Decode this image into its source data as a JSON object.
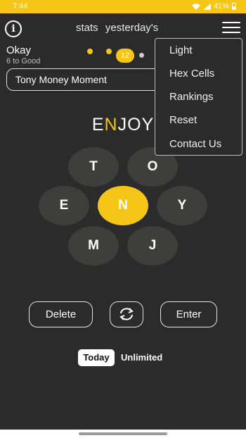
{
  "status": {
    "time": "7:44",
    "battery": "41%"
  },
  "header": {
    "info_icon": "info-icon",
    "nav": [
      "stats",
      "yesterday's"
    ],
    "menu_icon": "hamburger-menu-icon"
  },
  "progress": {
    "rank": "Okay",
    "to_next": "6 to Good",
    "score": "12"
  },
  "found_words": "Tony Money Moment",
  "current_word": {
    "before": "E",
    "center": "N",
    "after": "JOY"
  },
  "letters": {
    "top_left": "T",
    "top_right": "O",
    "left": "E",
    "center": "N",
    "right": "Y",
    "bottom_left": "M",
    "bottom_right": "J"
  },
  "buttons": {
    "delete": "Delete",
    "shuffle_icon": "shuffle-icon",
    "enter": "Enter"
  },
  "modes": {
    "today": "Today",
    "unlimited": "Unlimited"
  },
  "menu": {
    "items": [
      "Light",
      "Hex Cells",
      "Rankings",
      "Reset",
      "Contact Us"
    ]
  },
  "colors": {
    "accent": "#f5c518",
    "background": "#2b2b2b",
    "hex": "#3e3e3c"
  }
}
